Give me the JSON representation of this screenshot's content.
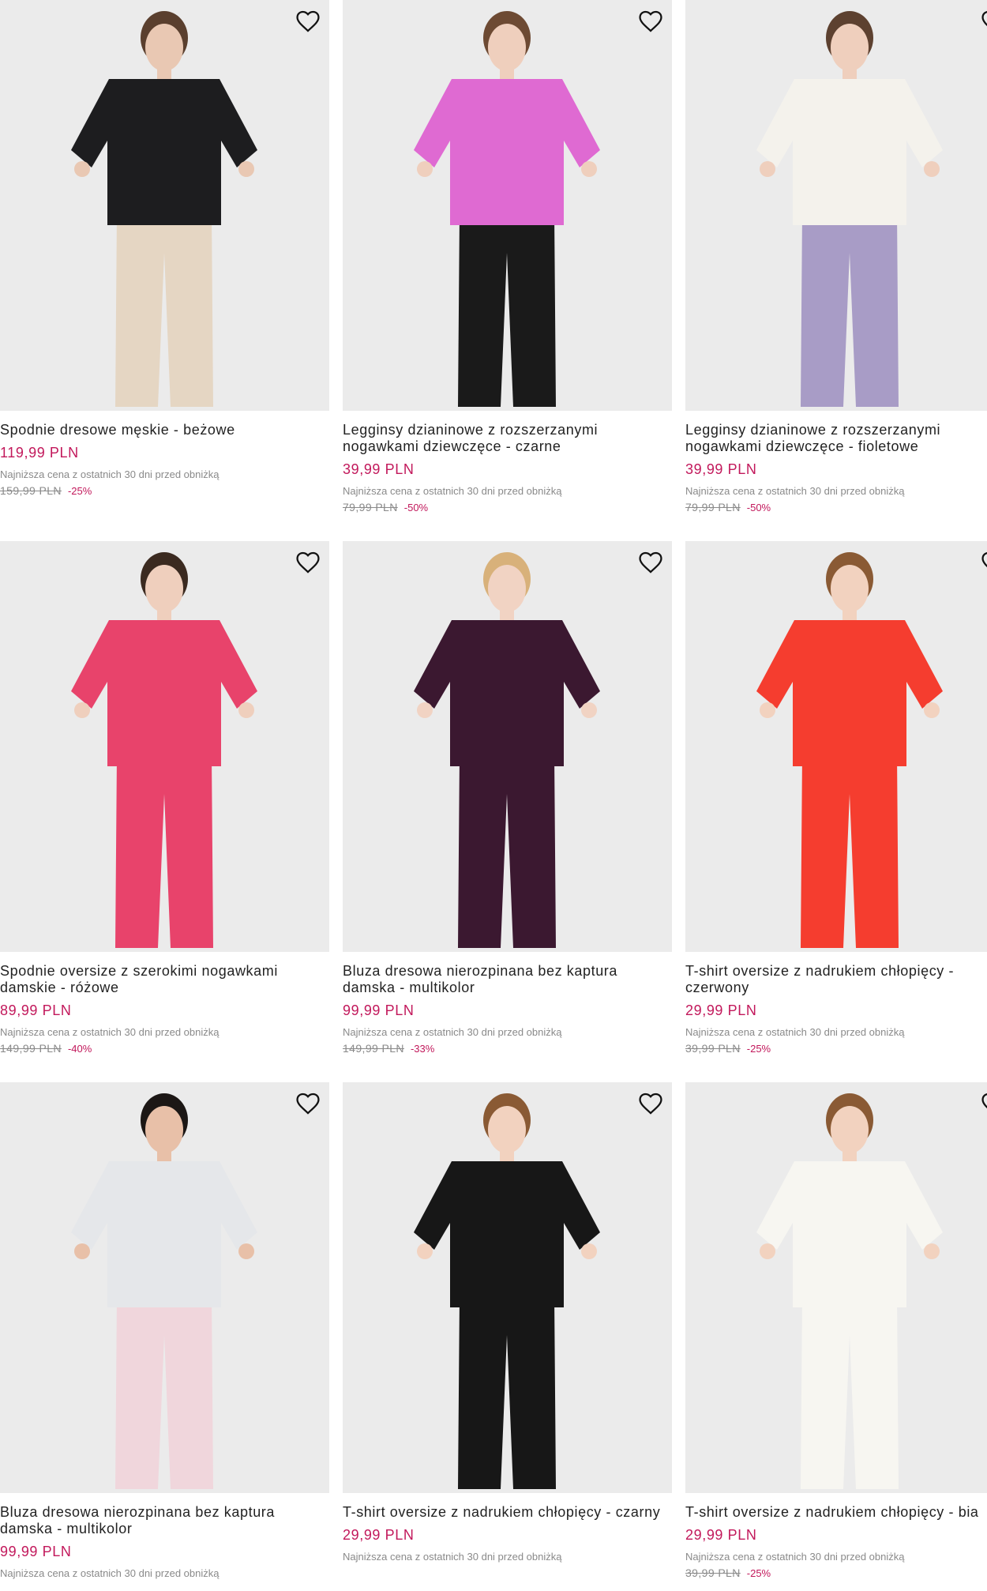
{
  "colors": {
    "price": "#c2185b",
    "muted": "#8a8a8a",
    "photo_bg": "#ebebeb"
  },
  "icons": {
    "favorite": "heart-outline-icon"
  },
  "products": [
    {
      "title": "Spodnie dresowe męskie - beżowe",
      "price": "119,99 PLN",
      "note": "Najniższa cena z ostatnich 30 dni przed obniżką",
      "old_price": "159,99 PLN",
      "discount": "-25%",
      "colors": {
        "top": "#1d1d1f",
        "bottom": "#e5d6c3",
        "skin": "#e9c8b3",
        "hair": "#5a3f2e"
      }
    },
    {
      "title": "Legginsy dzianinowe z rozszerzanymi nogawkami dziewczęce - czarne",
      "price": "39,99 PLN",
      "note": "Najniższa cena z ostatnich 30 dni przed obniżką",
      "old_price": "79,99 PLN",
      "discount": "-50%",
      "colors": {
        "top": "#df6ad2",
        "bottom": "#1a1a1a",
        "skin": "#efcfbd",
        "hair": "#6d4a33"
      }
    },
    {
      "title": "Legginsy dzianinowe z rozszerzanymi nogawkami dziewczęce - fioletowe",
      "price": "39,99 PLN",
      "note": "Najniższa cena z ostatnich 30 dni przed obniżką",
      "old_price": "79,99 PLN",
      "discount": "-50%",
      "colors": {
        "top": "#f4f2ec",
        "bottom": "#a89cc6",
        "skin": "#efcfbd",
        "hair": "#5d4130"
      }
    },
    {
      "title": "Spodnie oversize z szerokimi nogawkami damskie - różowe",
      "price": "89,99 PLN",
      "note": "Najniższa cena z ostatnich 30 dni przed obniżką",
      "old_price": "149,99 PLN",
      "discount": "-40%",
      "colors": {
        "top": "#e8436b",
        "bottom": "#e8436b",
        "skin": "#efcfbd",
        "hair": "#3b2a20"
      }
    },
    {
      "title": "Bluza dresowa nierozpinana bez kaptura damska - multikolor",
      "price": "99,99 PLN",
      "note": "Najniższa cena z ostatnich 30 dni przed obniżką",
      "old_price": "149,99 PLN",
      "discount": "-33%",
      "colors": {
        "top": "#3b1830",
        "bottom": "#3b1830",
        "skin": "#f1d3c3",
        "hair": "#d8b17a"
      }
    },
    {
      "title": "T-shirt oversize z nadrukiem chłopięcy - czerwony",
      "price": "29,99 PLN",
      "note": "Najniższa cena z ostatnich 30 dni przed obniżką",
      "old_price": "39,99 PLN",
      "discount": "-25%",
      "colors": {
        "top": "#f53d2f",
        "bottom": "#f53d2f",
        "skin": "#f2d2bf",
        "hair": "#8a5a34"
      }
    },
    {
      "title": "Bluza dresowa nierozpinana bez kaptura damska - multikolor",
      "price": "99,99 PLN",
      "note": "Najniższa cena z ostatnich 30 dni przed obniżką",
      "old_price": "",
      "discount": "",
      "colors": {
        "top": "#e5e7ea",
        "bottom": "#f0d6dc",
        "skin": "#e8c0a8",
        "hair": "#1c1715"
      }
    },
    {
      "title": "T-shirt oversize z nadrukiem chłopięcy - czarny",
      "price": "29,99 PLN",
      "note": "Najniższa cena z ostatnich 30 dni przed obniżką",
      "old_price": "",
      "discount": "",
      "colors": {
        "top": "#171717",
        "bottom": "#171717",
        "skin": "#f2d2bf",
        "hair": "#8a5a34"
      }
    },
    {
      "title": "T-shirt oversize z nadrukiem chłopięcy - bia",
      "price": "29,99 PLN",
      "note": "Najniższa cena z ostatnich 30 dni przed obniżką",
      "old_price": "39,99 PLN",
      "discount": "-25%",
      "colors": {
        "top": "#f7f6f1",
        "bottom": "#f7f6f1",
        "skin": "#f2d2bf",
        "hair": "#8a5a34"
      }
    }
  ]
}
